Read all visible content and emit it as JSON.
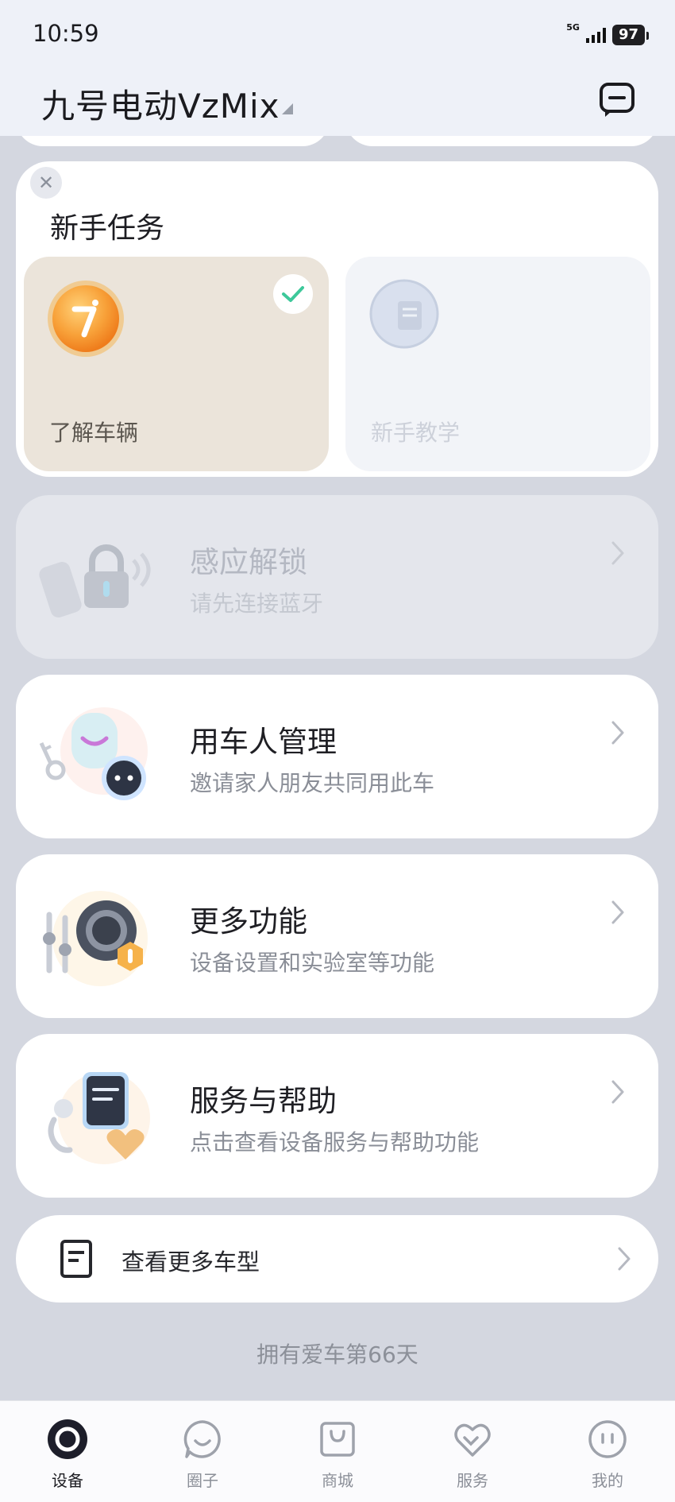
{
  "status_bar": {
    "time": "10:59",
    "network": "5G",
    "battery": "97"
  },
  "header": {
    "title": "九号电动VzMix"
  },
  "new_tasks": {
    "title": "新手任务",
    "items": [
      {
        "label": "了解车辆",
        "completed": true
      },
      {
        "label": "新手教学",
        "completed": false
      }
    ]
  },
  "features": [
    {
      "title": "感应解锁",
      "subtitle": "请先连接蓝牙",
      "enabled": false
    },
    {
      "title": "用车人管理",
      "subtitle": "邀请家人朋友共同用此车",
      "enabled": true
    },
    {
      "title": "更多功能",
      "subtitle": "设备设置和实验室等功能",
      "enabled": true
    },
    {
      "title": "服务与帮助",
      "subtitle": "点击查看设备服务与帮助功能",
      "enabled": true
    }
  ],
  "more_models": {
    "label": "查看更多车型"
  },
  "footer": {
    "text": "拥有爱车第66天"
  },
  "bottom_nav": {
    "items": [
      {
        "label": "设备",
        "icon": "device-icon",
        "active": true
      },
      {
        "label": "圈子",
        "icon": "community-icon",
        "active": false
      },
      {
        "label": "商城",
        "icon": "shop-bag-icon",
        "active": false
      },
      {
        "label": "服务",
        "icon": "service-heart-icon",
        "active": false
      },
      {
        "label": "我的",
        "icon": "profile-icon",
        "active": false
      }
    ]
  },
  "colors": {
    "background": "#d4d7e0",
    "accent_check": "#3dc89a",
    "coin": "#f59a2b"
  }
}
